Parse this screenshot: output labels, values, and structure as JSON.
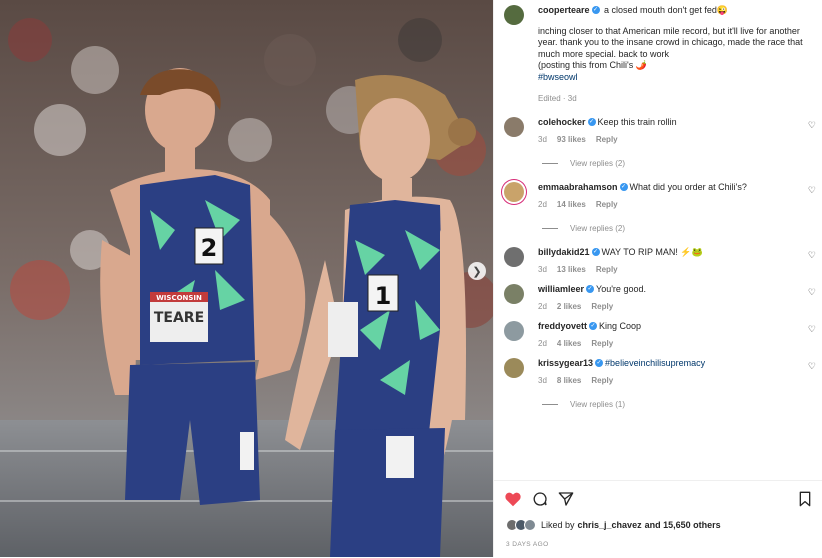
{
  "post": {
    "author": "cooperteare",
    "caption_title": " a closed mouth don't get fed😜",
    "caption_lines": [
      "inching closer to that American mile record, but it'll live for another year. thank you to the insane crowd in chicago, made the race that much more special. back to work",
      "(posting this from Chili's 🌶️"
    ],
    "hashtag": "#bwseowl",
    "edited": "Edited · 3d"
  },
  "comments": [
    {
      "user": "colehocker",
      "text": "Keep this train rollin",
      "time": "3d",
      "likes": "93 likes",
      "reply": "Reply",
      "views": "View replies (2)",
      "avatar": "#8a7b6a"
    },
    {
      "user": "emmaabrahamson",
      "text": "What did you order at Chili's?",
      "time": "2d",
      "likes": "14 likes",
      "reply": "Reply",
      "views": "View replies (2)",
      "avatar": "#c9a36a",
      "ring": true
    },
    {
      "user": "billydakid21",
      "text": "WAY TO RIP MAN! ⚡🐸",
      "time": "3d",
      "likes": "13 likes",
      "reply": "Reply",
      "views": "",
      "avatar": "#6f6f6f"
    },
    {
      "user": "williamleer",
      "text": "You're good.",
      "time": "2d",
      "likes": "2 likes",
      "reply": "Reply",
      "views": "",
      "avatar": "#7a8066"
    },
    {
      "user": "freddyovett",
      "text": "King Coop",
      "time": "2d",
      "likes": "4 likes",
      "reply": "Reply",
      "views": "",
      "avatar": "#8d9aa0"
    },
    {
      "user": "krissygear13",
      "text": "#believeinchilisupremacy",
      "time": "3d",
      "likes": "8 likes",
      "reply": "Reply",
      "views": "View replies (1)",
      "avatar": "#9b8a5a",
      "hashtag": true
    }
  ],
  "footer": {
    "liked_prefix": "Liked by",
    "liked_user": "chris_j_chavez",
    "liked_suffix": "and 15,650 others",
    "timestamp": "3 DAYS AGO"
  },
  "photo": {
    "bib_left_number": "2",
    "bib_right_number": "1",
    "bib_left_name": "TEARE",
    "bib_left_header": "WISCONSIN"
  },
  "icons": {
    "like": "heart-filled-icon",
    "comment": "comment-icon",
    "share": "paper-plane-icon",
    "save": "bookmark-icon",
    "next": "chevron-right-icon"
  },
  "colors": {
    "like": "#ed4956",
    "verified": "#3897f0",
    "hashtag": "#00376b"
  }
}
